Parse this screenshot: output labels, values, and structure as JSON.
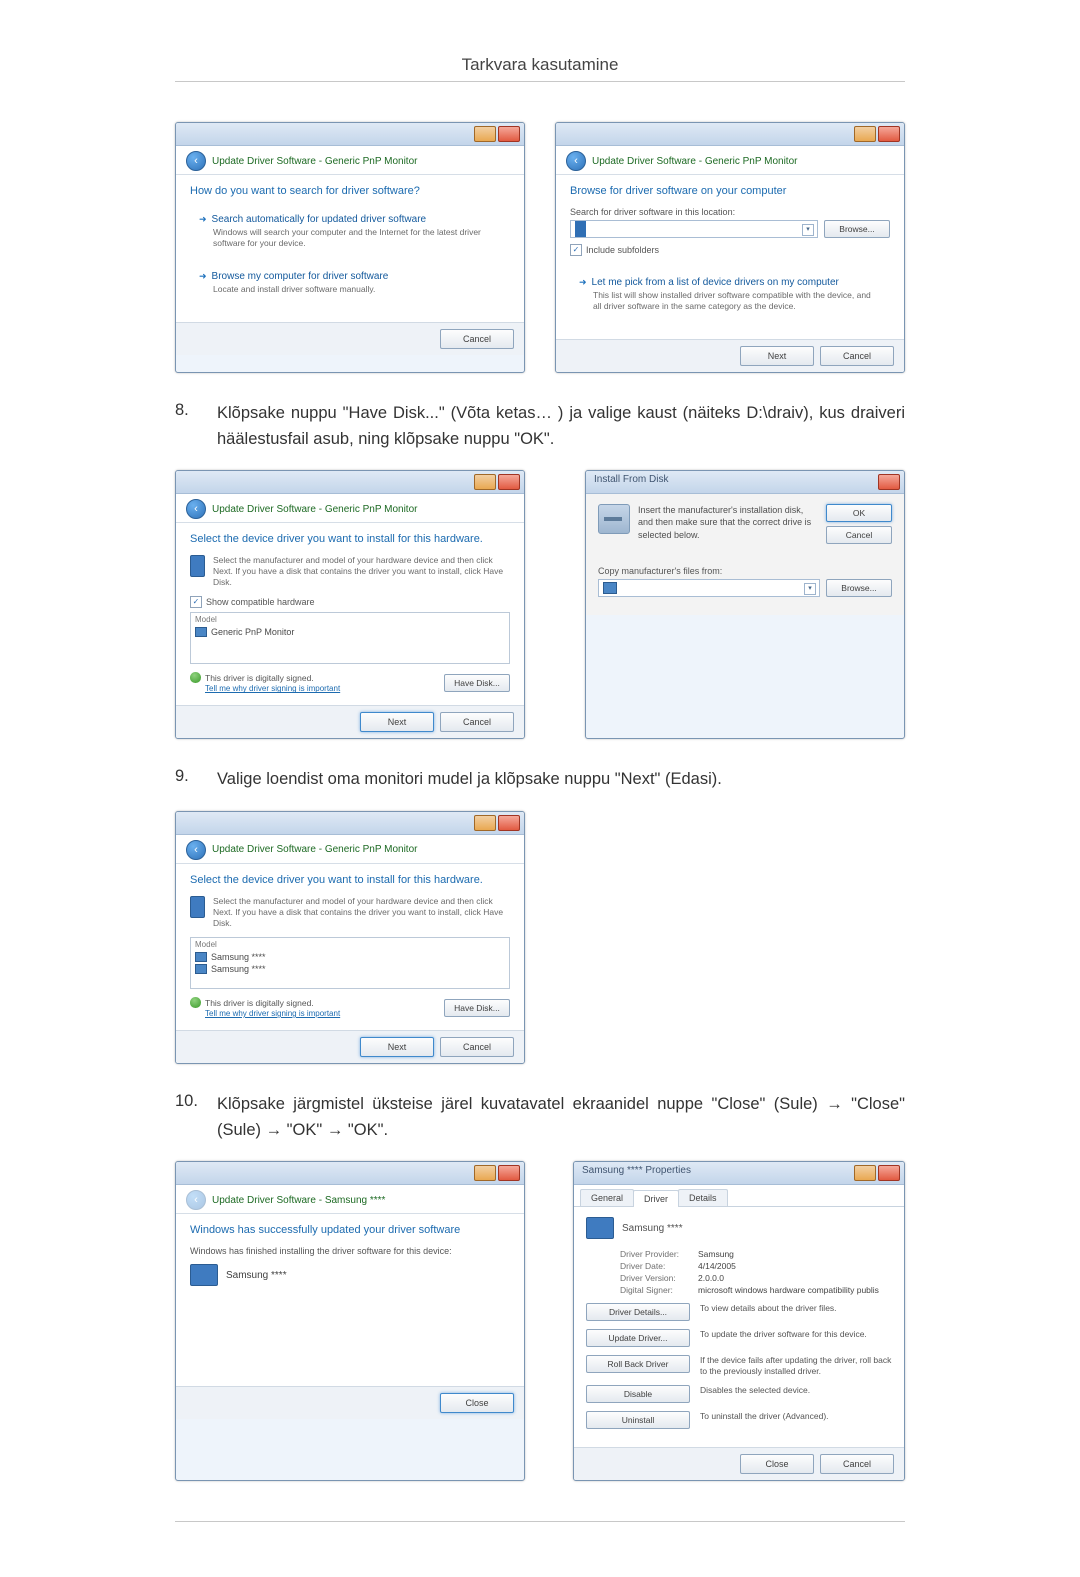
{
  "page_title": "Tarkvara kasutamine",
  "nav": {
    "crumb": "Update Driver Software - Generic PnP Monitor",
    "crumb_samsung": "Update Driver Software - Samsung ****"
  },
  "dlg1": {
    "heading": "How do you want to search for driver software?",
    "optA_title": "Search automatically for updated driver software",
    "optA_desc": "Windows will search your computer and the Internet for the latest driver software for your device.",
    "optB_title": "Browse my computer for driver software",
    "optB_desc": "Locate and install driver software manually.",
    "cancel": "Cancel"
  },
  "dlg2": {
    "heading": "Browse for driver software on your computer",
    "search_label": "Search for driver software in this location:",
    "browse": "Browse...",
    "include": "Include subfolders",
    "optC_title": "Let me pick from a list of device drivers on my computer",
    "optC_desc": "This list will show installed driver software compatible with the device, and all driver software in the same category as the device.",
    "next": "Next",
    "cancel": "Cancel"
  },
  "step8": {
    "num": "8.",
    "text": "Klõpsake nuppu \"Have Disk...\" (Võta ketas… ) ja valige kaust (näiteks D:\\draiv), kus draiveri häälestusfail asub, ning klõpsake nuppu \"OK\"."
  },
  "dlg3": {
    "heading": "Select the device driver you want to install for this hardware.",
    "sub": "Select the manufacturer and model of your hardware device and then click Next. If you have a disk that contains the driver you want to install, click Have Disk.",
    "show_compat": "Show compatible hardware",
    "model_head": "Model",
    "model_item": "Generic PnP Monitor",
    "signed": "This driver is digitally signed.",
    "tell": "Tell me why driver signing is important",
    "have_disk": "Have Disk...",
    "next": "Next",
    "cancel": "Cancel"
  },
  "dlg4": {
    "title": "Install From Disk",
    "msg": "Insert the manufacturer's installation disk, and then make sure that the correct drive is selected below.",
    "ok": "OK",
    "cancel": "Cancel",
    "copy_label": "Copy manufacturer's files from:",
    "browse": "Browse..."
  },
  "step9": {
    "num": "9.",
    "text": "Valige loendist oma monitori mudel ja klõpsake nuppu \"Next\" (Edasi)."
  },
  "dlg5": {
    "heading": "Select the device driver you want to install for this hardware.",
    "sub": "Select the manufacturer and model of your hardware device and then click Next. If you have a disk that contains the driver you want to install, click Have Disk.",
    "model_head": "Model",
    "model_item1": "Samsung ****",
    "model_item2": "Samsung ****",
    "signed": "This driver is digitally signed.",
    "tell": "Tell me why driver signing is important",
    "have_disk": "Have Disk...",
    "next": "Next",
    "cancel": "Cancel"
  },
  "step10": {
    "num": "10.",
    "text": "Klõpsake järgmistel üksteise järel kuvatavatel ekraanidel nuppe \"Close\" (Sule) → \"Close\" (Sule) → \"OK\" → \"OK\"."
  },
  "dlg6": {
    "heading": "Windows has successfully updated your driver software",
    "sub": "Windows has finished installing the driver software for this device:",
    "device": "Samsung ****",
    "close": "Close"
  },
  "dlg7": {
    "title": "Samsung **** Properties",
    "tabs": {
      "general": "General",
      "driver": "Driver",
      "details": "Details"
    },
    "device": "Samsung ****",
    "provider_k": "Driver Provider:",
    "provider_v": "Samsung",
    "date_k": "Driver Date:",
    "date_v": "4/14/2005",
    "version_k": "Driver Version:",
    "version_v": "2.0.0.0",
    "signer_k": "Digital Signer:",
    "signer_v": "microsoft windows hardware compatibility publis",
    "b_details": "Driver Details...",
    "b_details_desc": "To view details about the driver files.",
    "b_update": "Update Driver...",
    "b_update_desc": "To update the driver software for this device.",
    "b_rollback": "Roll Back Driver",
    "b_rollback_desc": "If the device fails after updating the driver, roll back to the previously installed driver.",
    "b_disable": "Disable",
    "b_disable_desc": "Disables the selected device.",
    "b_uninstall": "Uninstall",
    "b_uninstall_desc": "To uninstall the driver (Advanced).",
    "close": "Close",
    "cancel": "Cancel"
  }
}
